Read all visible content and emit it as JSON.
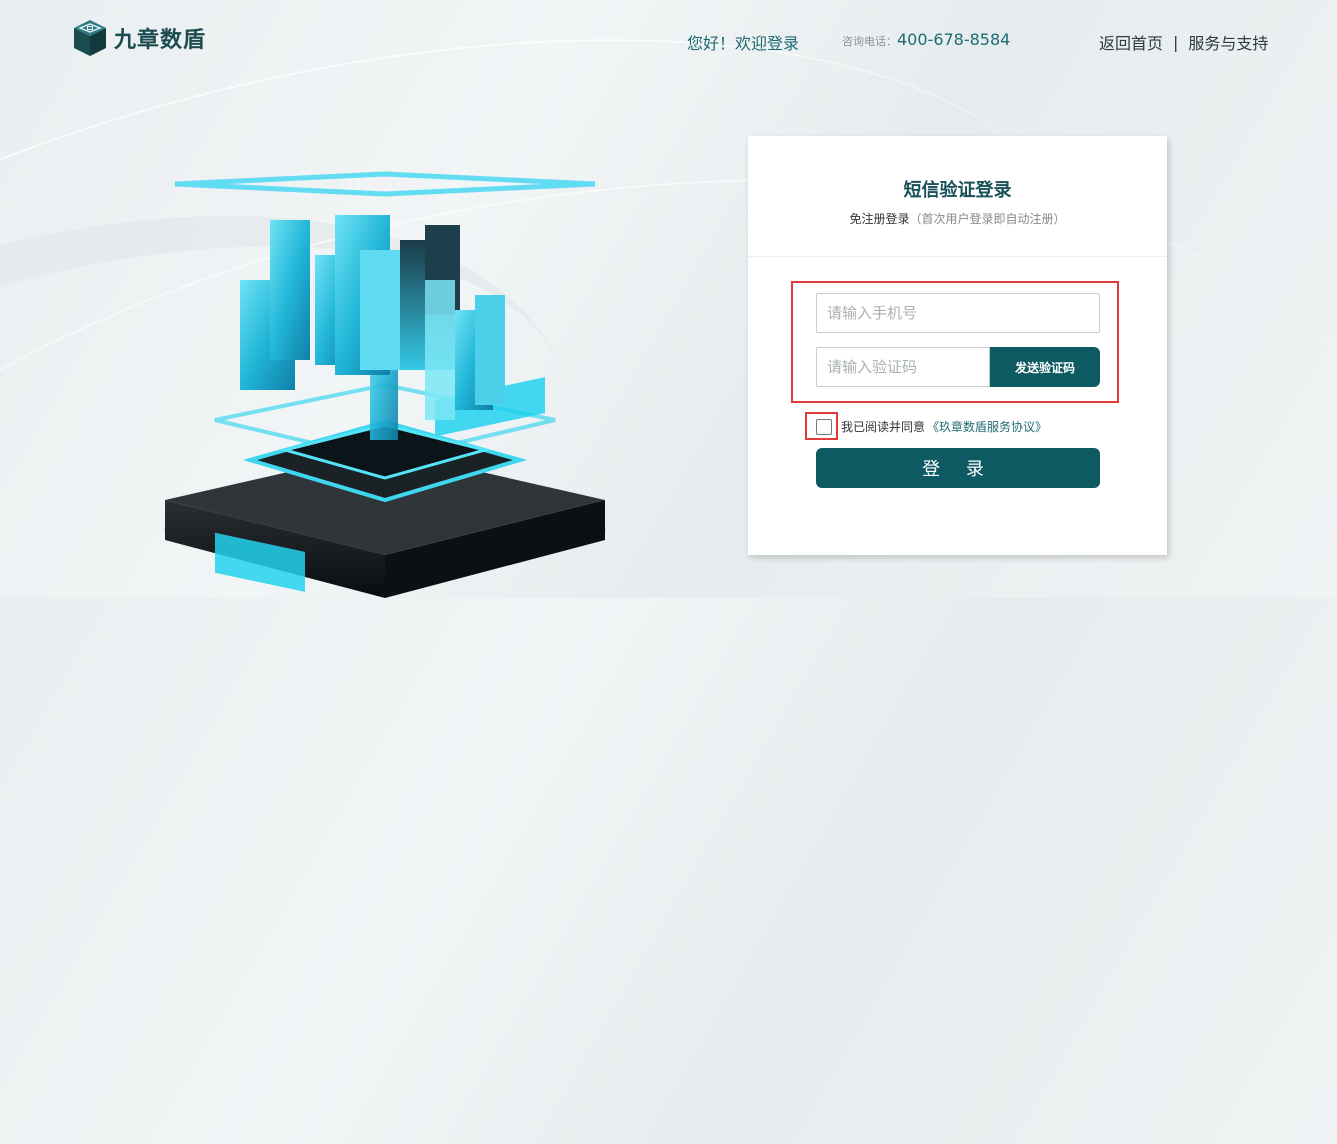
{
  "header": {
    "logo_text": "九章数盾",
    "greeting": "您好！欢迎登录",
    "phone_label": "咨询电话：",
    "phone_number": "400-678-8584",
    "nav": {
      "home": "返回首页",
      "separator": "|",
      "support": "服务与支持"
    }
  },
  "login": {
    "title": "短信验证登录",
    "subtitle_main": "免注册登录",
    "subtitle_note": "（首次用户登录即自动注册）",
    "phone_placeholder": "请输入手机号",
    "phone_value": "",
    "code_placeholder": "请输入验证码",
    "code_value": "",
    "send_code_label": "发送验证码",
    "agree_text": "我已阅读并同意",
    "agreement_link": "《玖章数盾服务协议》",
    "agree_checked": false,
    "login_label": "登 录"
  },
  "colors": {
    "brand": "#0e5a63",
    "highlight": "#e03a3a",
    "accent_cyan": "#3fd6f0"
  },
  "icons": {
    "logo": "cube-logo-icon",
    "illustration": "data-tower-illustration"
  }
}
